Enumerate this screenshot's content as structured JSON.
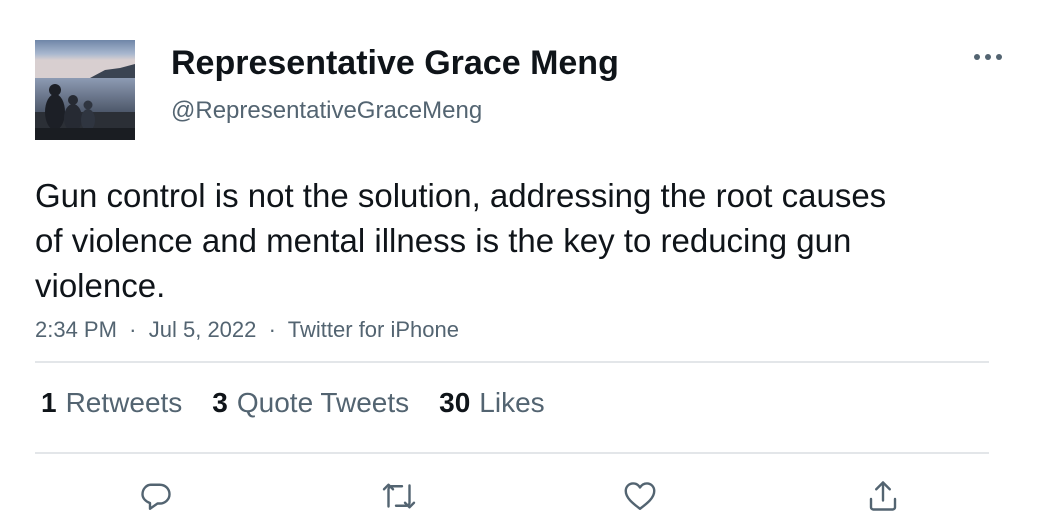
{
  "author": {
    "display_name": "Representative Grace Meng",
    "handle": "@RepresentativeGraceMeng",
    "avatar_icon": "profile-photo-lakeside"
  },
  "tweet": {
    "text": "Gun control is not the solution, addressing the root causes of violence and mental illness is the key to reducing gun violence.",
    "time": "2:34 PM",
    "date": "Jul 5, 2022",
    "source": "Twitter for iPhone",
    "separator": "·"
  },
  "stats": {
    "retweets": {
      "count": "1",
      "label": "Retweets"
    },
    "quote_tweets": {
      "count": "3",
      "label": "Quote Tweets"
    },
    "likes": {
      "count": "30",
      "label": "Likes"
    }
  },
  "actions": {
    "reply_icon": "reply-icon",
    "retweet_icon": "retweet-icon",
    "like_icon": "heart-icon",
    "share_icon": "share-icon",
    "more_icon": "more-icon"
  },
  "colors": {
    "text_primary": "#0f1419",
    "text_secondary": "#536471",
    "divider": "#e3e6e9"
  }
}
